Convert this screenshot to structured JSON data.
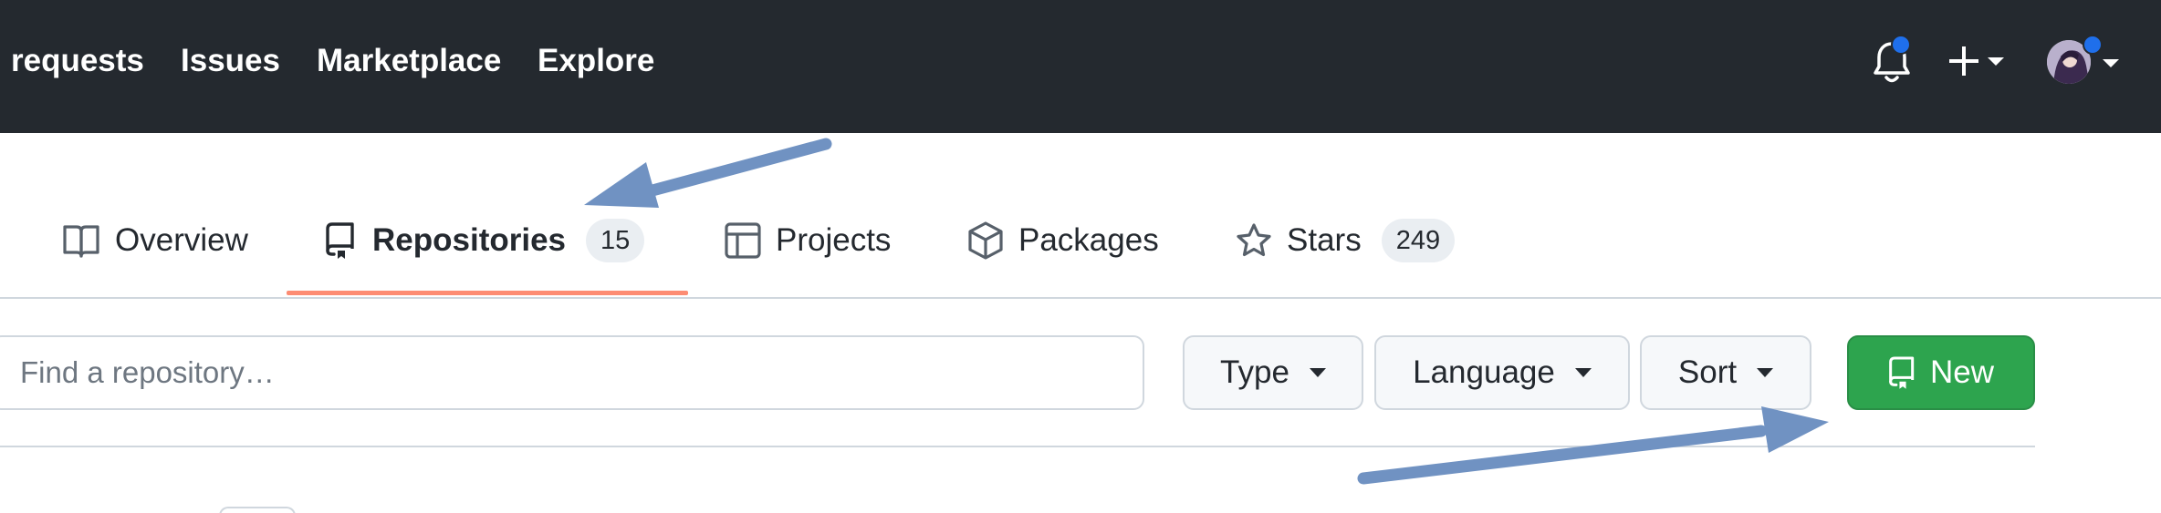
{
  "header": {
    "nav": [
      "requests",
      "Issues",
      "Marketplace",
      "Explore"
    ],
    "icons": [
      "bell-icon",
      "plus-icon",
      "avatar"
    ]
  },
  "tabs": [
    {
      "label": "Overview",
      "icon": "book-icon"
    },
    {
      "label": "Repositories",
      "icon": "repo-icon",
      "count": "15",
      "active": true
    },
    {
      "label": "Projects",
      "icon": "table-icon"
    },
    {
      "label": "Packages",
      "icon": "package-icon"
    },
    {
      "label": "Stars",
      "icon": "star-icon",
      "count": "249"
    }
  ],
  "filters": {
    "search_placeholder": "Find a repository…",
    "search_value": "",
    "type_label": "Type",
    "language_label": "Language",
    "sort_label": "Sort",
    "new_label": "New"
  },
  "colors": {
    "header_bg": "#24292f",
    "accent_underline": "#fd8c73",
    "new_button": "#2da44e",
    "annotation_arrow": "#7092c2",
    "notification_dot": "#1f6feb"
  }
}
